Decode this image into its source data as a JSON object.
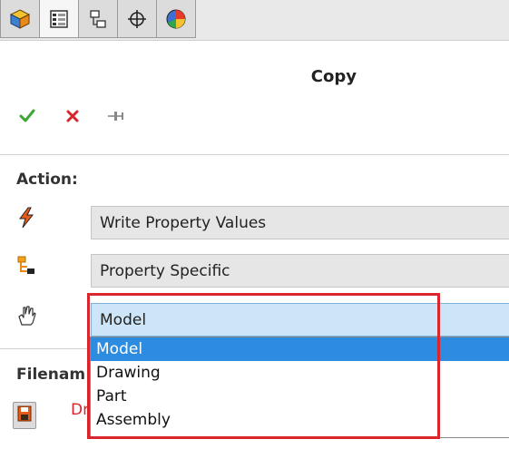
{
  "tabs": [
    {
      "icon": "cube-icon",
      "active": false
    },
    {
      "icon": "property-manager-icon",
      "active": true
    },
    {
      "icon": "configuration-manager-icon",
      "active": false
    },
    {
      "icon": "crosshair-icon",
      "active": false
    },
    {
      "icon": "appearance-pie-icon",
      "active": false
    }
  ],
  "title": "Copy",
  "toolbar": {
    "ok_icon": "checkmark-icon",
    "cancel_icon": "close-icon",
    "pin_icon": "pushpin-icon"
  },
  "action_section": {
    "label": "Action:",
    "rows": [
      {
        "icon": "lightning-icon",
        "value": "Write Property Values"
      },
      {
        "icon": "hierarchy-icon",
        "value": "Property Specific"
      },
      {
        "icon": "hand-icon",
        "value": "Model"
      }
    ]
  },
  "dropdown": {
    "options": [
      "Model",
      "Drawing",
      "Part",
      "Assembly"
    ],
    "highlighted": "Model"
  },
  "filename_section": {
    "label": "Filenam",
    "snippet": "Dr",
    "icon": "save-disk-icon"
  },
  "colors": {
    "accent": "#2e8ce0",
    "selected_field": "#cde6f7",
    "highlight_frame": "#d9252b",
    "ok": "#3aa832",
    "cancel": "#d9252b"
  }
}
